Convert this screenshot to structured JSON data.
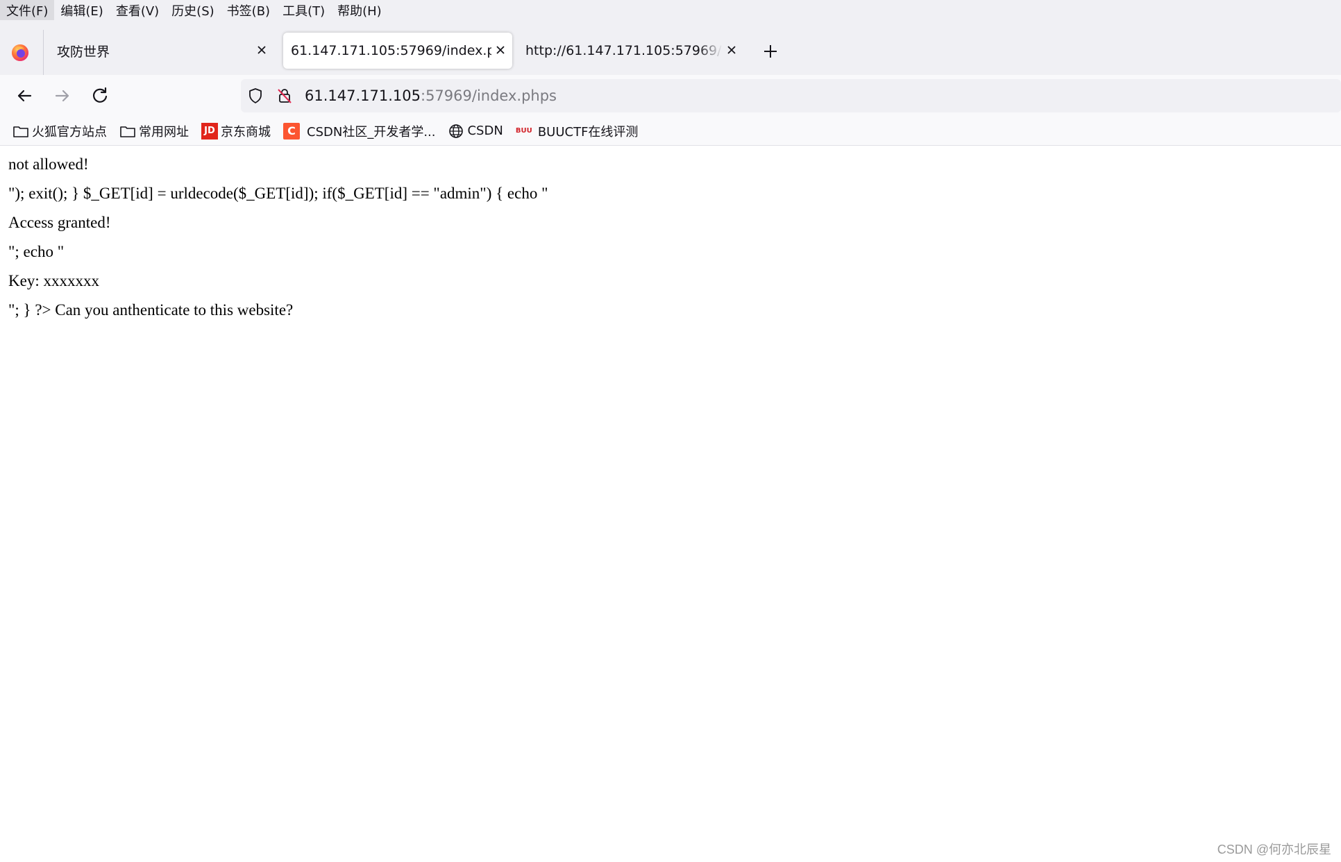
{
  "menubar": {
    "items": [
      "文件(F)",
      "编辑(E)",
      "查看(V)",
      "历史(S)",
      "书签(B)",
      "工具(T)",
      "帮助(H)"
    ]
  },
  "tabs": [
    {
      "label": "攻防世界",
      "selected": false
    },
    {
      "label": "61.147.171.105:57969/index.phps",
      "selected": true
    },
    {
      "label": "http://61.147.171.105:57969/inde",
      "selected": false
    }
  ],
  "urlbar": {
    "host": "61.147.171.105",
    "rest": ":57969/index.phps"
  },
  "bookmarks": [
    {
      "label": "火狐官方站点",
      "icon": "folder-icon"
    },
    {
      "label": "常用网址",
      "icon": "folder-icon"
    },
    {
      "label": "京东商城",
      "icon": "jd-icon",
      "icon_text": "JD"
    },
    {
      "label": "CSDN社区_开发者学...",
      "icon": "csdn-icon",
      "icon_text": "C"
    },
    {
      "label": "CSDN",
      "icon": "globe-icon"
    },
    {
      "label": "BUUCTF在线评测",
      "icon": "buuctf-icon",
      "icon_text": "BUU"
    }
  ],
  "content": {
    "lines": [
      "not allowed!",
      "\"); exit(); } $_GET[id] = urldecode($_GET[id]); if($_GET[id] == \"admin\") { echo \"",
      "Access granted!",
      "\"; echo \"",
      "Key: xxxxxxx",
      "\"; } ?> Can you anthenticate to this website?"
    ]
  },
  "watermark": "CSDN @何亦北辰星",
  "colors": {
    "chrome_bg": "#f0f0f4",
    "toolbar_bg": "#f9f9fb",
    "text": "#15141a",
    "url_dim": "#7a7a80"
  }
}
